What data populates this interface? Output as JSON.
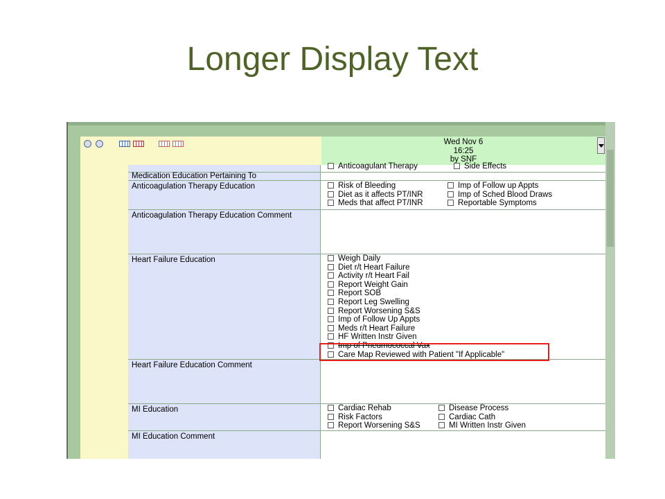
{
  "slide": {
    "title": "Longer Display Text"
  },
  "header": {
    "date_line1": "Wed Nov 6",
    "date_line2": "16:25",
    "date_line3": "by SNF"
  },
  "toolbar": {
    "icons": [
      "minus-circle-icon",
      "plus-circle-icon",
      "grid-blue-icon",
      "grid-red-icon",
      "grid-pink-icon",
      "grid-pink-2-icon"
    ]
  },
  "form": {
    "partial_row": {
      "items": [
        "Anticoagulant Therapy",
        "Side Effects"
      ]
    },
    "rows": [
      {
        "label": "Medication Education Pertaining To"
      },
      {
        "label": "Anticoagulation Therapy Education",
        "items": [
          "Risk of Bleeding",
          "Imp of Follow up Appts",
          "Diet as it affects PT/INR",
          "Imp of Sched Blood Draws",
          "Meds that affect PT/INR",
          "Reportable Symptoms"
        ]
      },
      {
        "label": "Anticoagulation Therapy Education Comment"
      },
      {
        "label": "Heart Failure Education",
        "items": [
          "Weigh Daily",
          "Diet r/t Heart Failure",
          "Activity r/t Heart  Fail",
          "Report Weight Gain",
          "Report SOB",
          "Report Leg Swelling",
          "Report Worsening S&S",
          "Imp of Follow Up Appts",
          "Meds r/t Heart Failure",
          "HF Written Instr Given",
          "Imp of Pneumococcal Vax",
          "Care Map Reviewed with Patient \"If Applicable\""
        ]
      },
      {
        "label": "Heart Failure Education Comment"
      },
      {
        "label": "MI Education",
        "items": [
          "Cardiac Rehab",
          "Disease Process",
          "Risk Factors",
          "Cardiac Cath",
          "Report Worsening S&S",
          "MI Written Instr Given"
        ]
      },
      {
        "label": "MI Education Comment"
      }
    ]
  }
}
